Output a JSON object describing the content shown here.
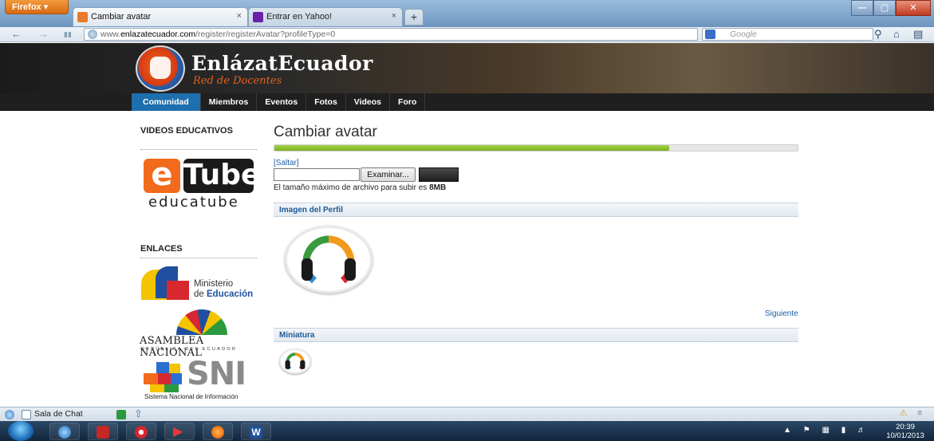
{
  "browser": {
    "menu_label": "Firefox ▾",
    "tabs": [
      {
        "title": "Cambiar avatar",
        "close": "×"
      },
      {
        "title": "Entrar en Yahoo!",
        "close": "×"
      }
    ],
    "new_tab": "+",
    "url_prefix": "www.",
    "url_host": "enlazatecuador.com",
    "url_path": "/register/registerAvatar?profileType=0",
    "search_placeholder": "Google",
    "window_controls": [
      "—",
      "▢",
      "✕"
    ]
  },
  "site": {
    "logo_title": "EnlázatEcuador",
    "logo_subtitle": "Red de Docentes",
    "nav": [
      "Comunidad",
      "Miembros",
      "Eventos",
      "Fotos",
      "Videos",
      "Foro"
    ]
  },
  "sidebar": {
    "videos_title": "VIDEOS EDUCATIVOS",
    "etube_e": "e",
    "etube_tube": "Tube",
    "etube_word": "educatube",
    "links_title": "ENLACES",
    "mineduc_1": "Ministerio",
    "mineduc_2a": "de ",
    "mineduc_2b": "Educación",
    "asamblea_1": "ASAMBLEA NACIONAL",
    "asamblea_2": "REPÚBLICA DEL ECUADOR",
    "sni_word": "SNI",
    "sni_caption": "Sistema Nacional de Información"
  },
  "main": {
    "title": "Cambiar avatar",
    "progress_fraction": 0.755,
    "skip_link": "[Saltar]",
    "browse_button": "Examinar...",
    "size_note_prefix": "El tamaño máximo de archivo para subir es ",
    "size_note_value": "8MB",
    "profile_section": "Imagen del Perfil",
    "next_link": "Siguiente",
    "thumb_section": "Miniatura"
  },
  "addon_bar": {
    "chat_label": "Sala de Chat"
  },
  "taskbar": {
    "time": "20:39",
    "date": "10/01/2013"
  },
  "colors": {
    "accent_blue": "#1e6fae",
    "progress_green": "#79b11e",
    "link_blue": "#1a5fa8",
    "brand_orange": "#f26a1c"
  }
}
